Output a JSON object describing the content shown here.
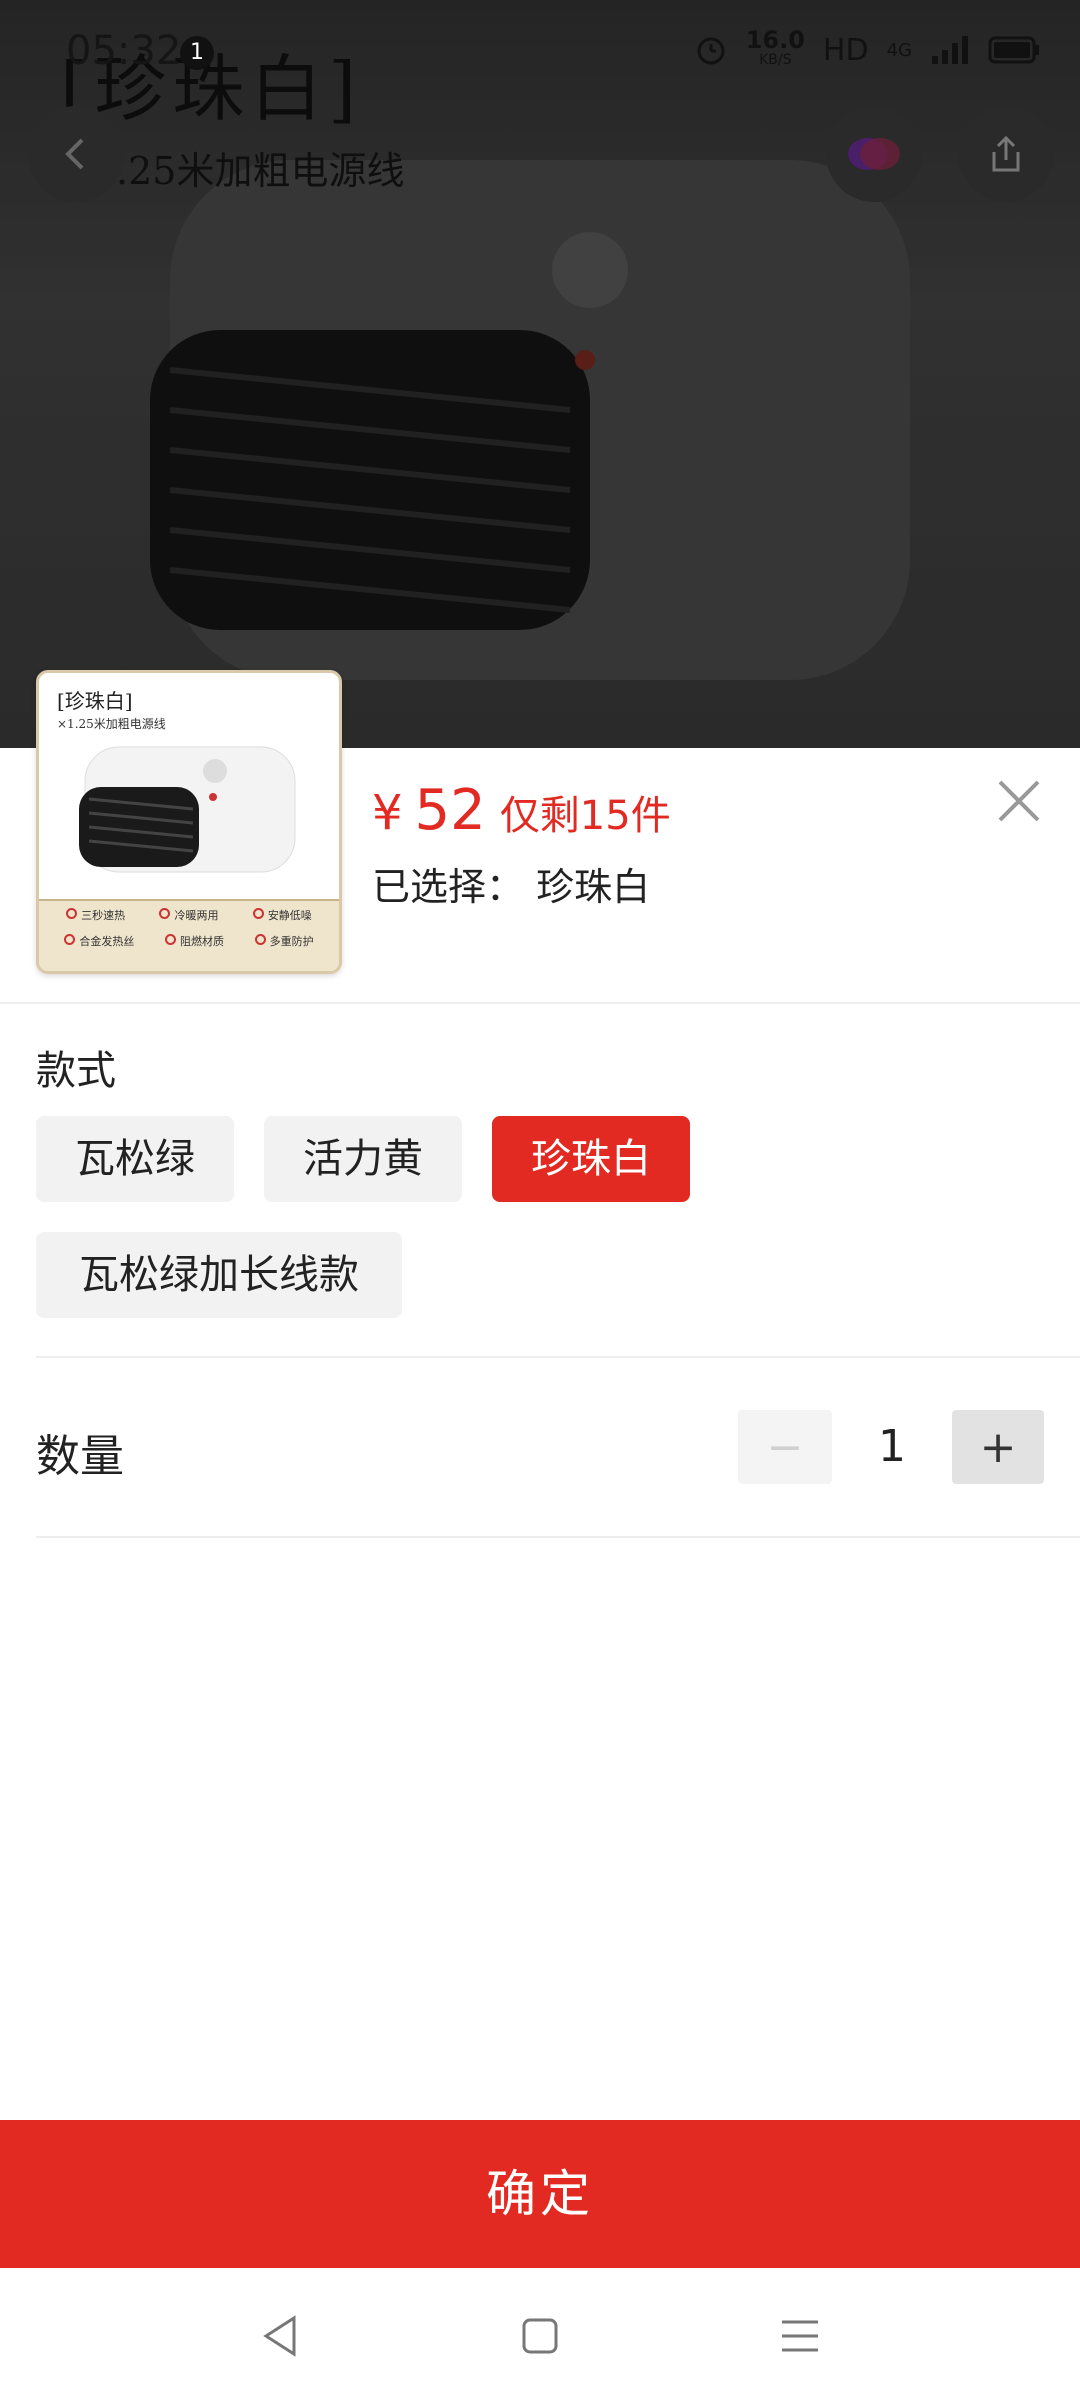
{
  "status_bar": {
    "time": "05:32",
    "notification_count": "1",
    "speed_value": "16.0",
    "speed_unit": "KB/S",
    "hd": "HD",
    "network": "4G"
  },
  "background_product": {
    "title": "[珍珠白]",
    "subtitle": "×1.25米加粗电源线"
  },
  "sheet": {
    "thumbnail": {
      "label": "[珍珠白]",
      "sublabel": "×1.25米加粗电源线",
      "features_row1": [
        "三秒速热",
        "冷暖两用",
        "安静低噪"
      ],
      "features_row2": [
        "合金发热丝",
        "阻燃材质",
        "多重防护"
      ]
    },
    "price": {
      "currency": "¥",
      "value": "52",
      "stock_text": "仅剩15件"
    },
    "selected": {
      "text": "已选择： 珍珠白"
    },
    "style_section": {
      "label": "款式",
      "options": [
        {
          "label": "瓦松绿"
        },
        {
          "label": "活力黄"
        },
        {
          "label": "珍珠白"
        },
        {
          "label": "瓦松绿加长线款"
        }
      ],
      "selected": "珍珠白"
    },
    "quantity": {
      "label": "数量",
      "minus": "−",
      "value": "1",
      "plus": "+"
    },
    "confirm_label": "确定"
  },
  "colors": {
    "accent": "#e22a22",
    "option_bg": "#f2f2f2"
  }
}
